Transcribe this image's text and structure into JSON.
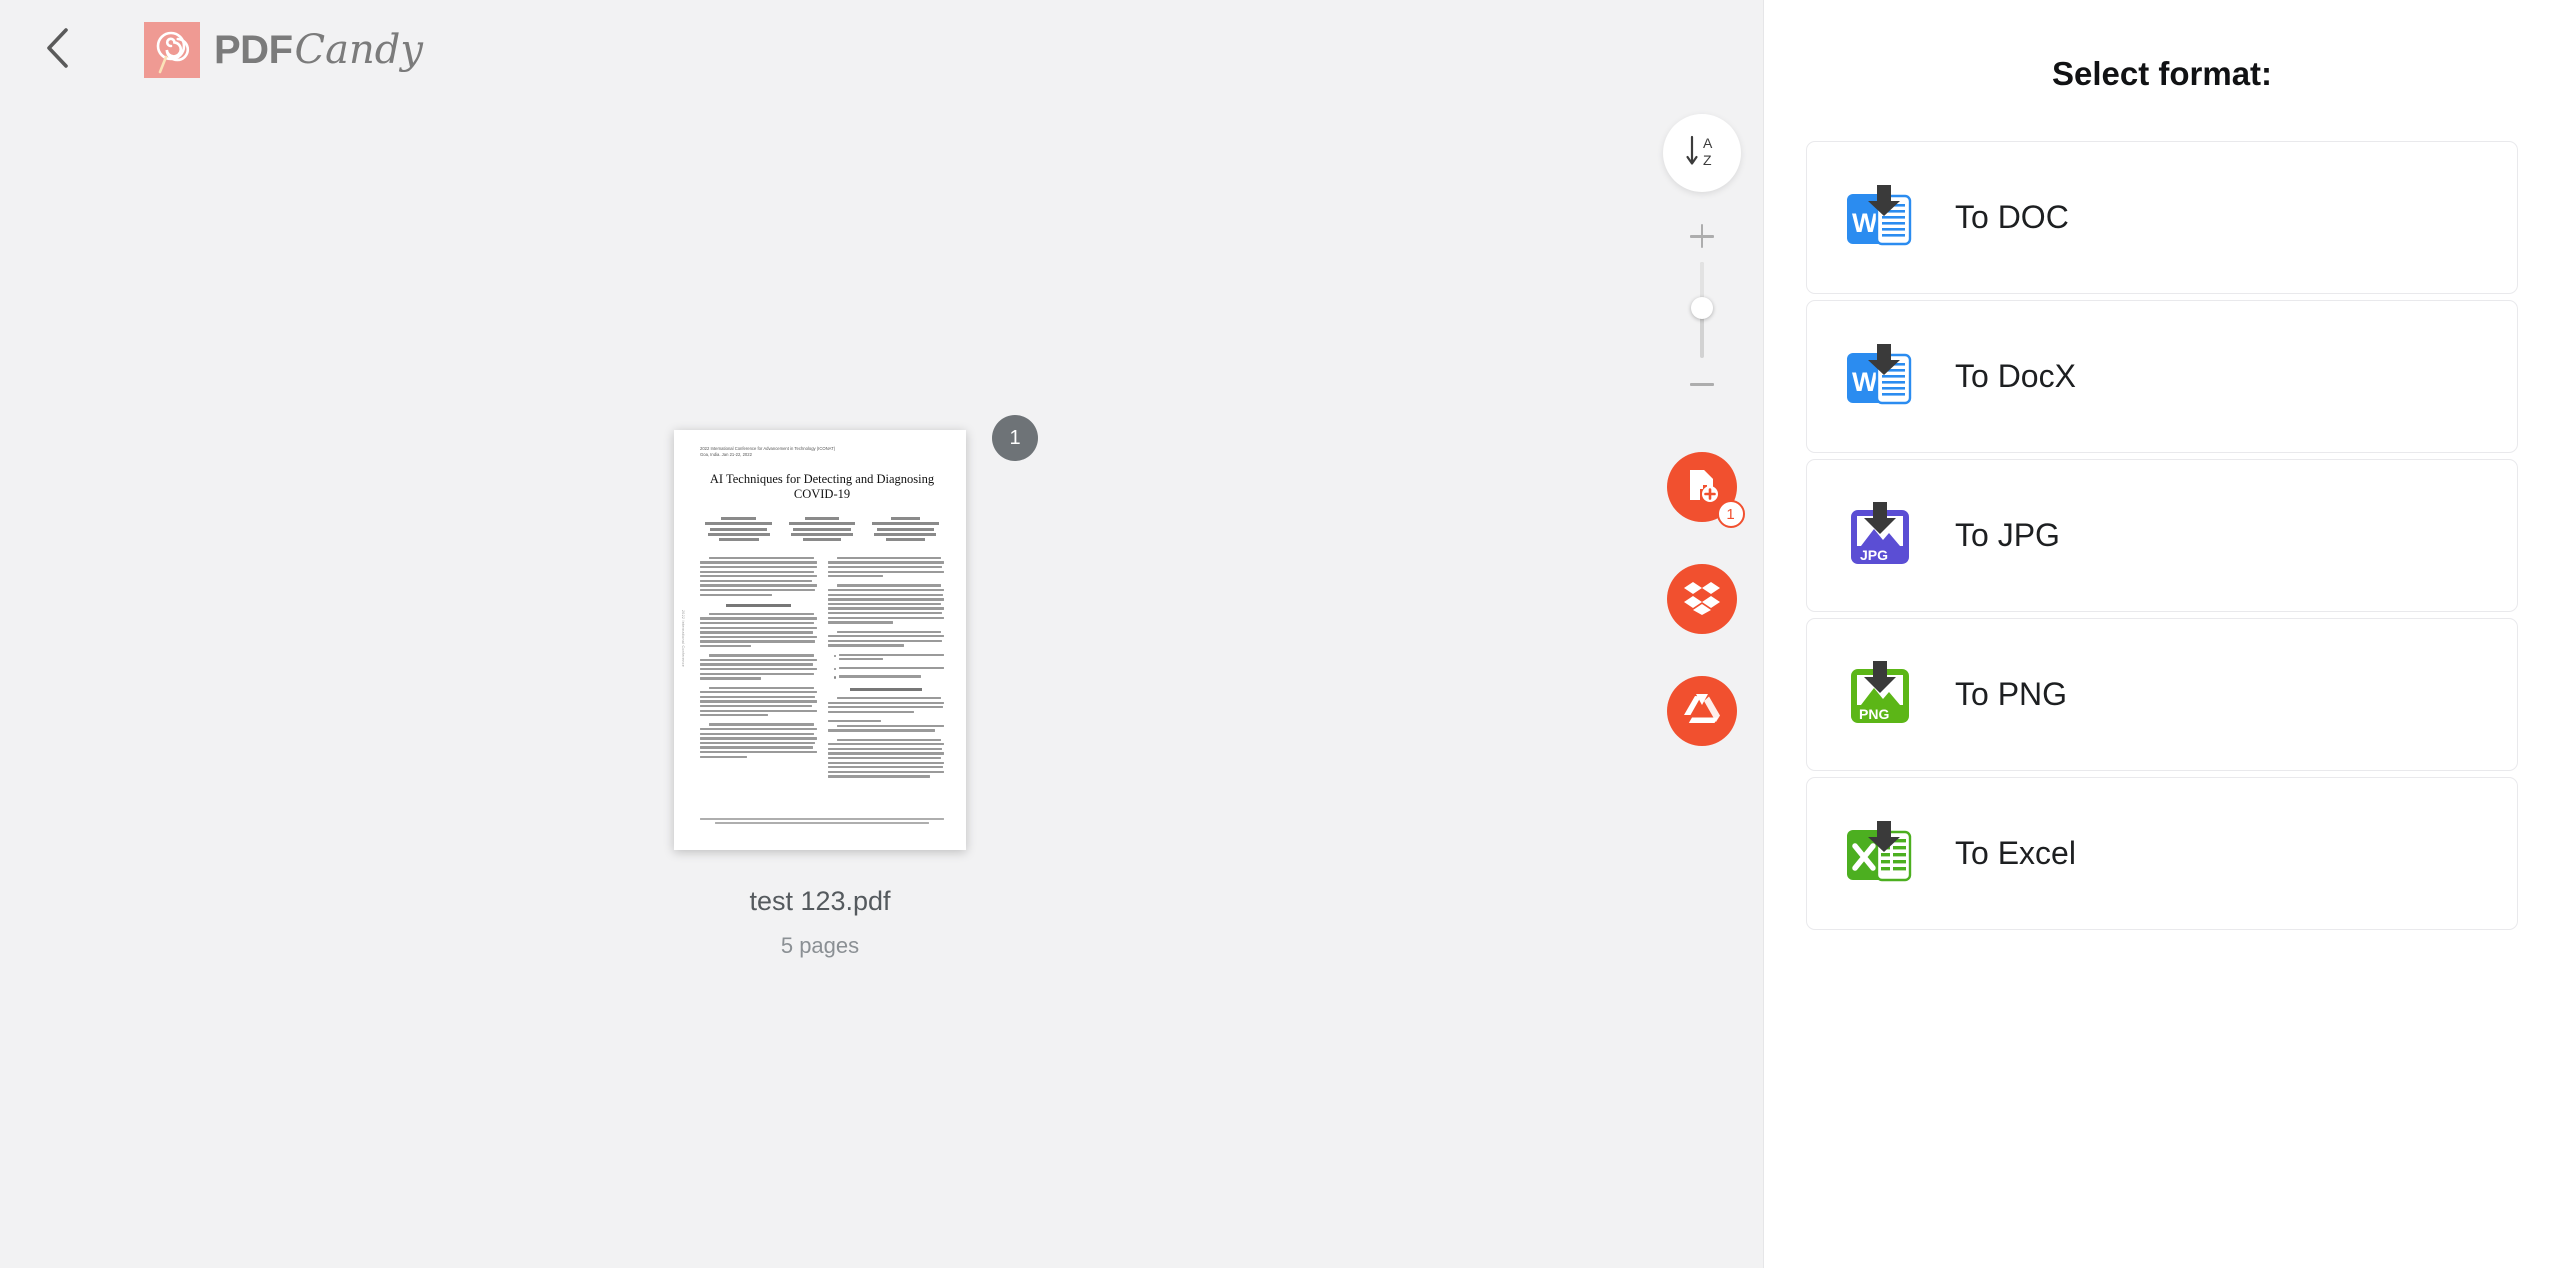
{
  "header": {
    "back_icon": "chevron-left-icon",
    "logo_mark_icon": "lollipop-icon",
    "logo_pdf": "PDF",
    "logo_candy": "Candy"
  },
  "workspace": {
    "file": {
      "name": "test 123.pdf",
      "pages_label": "5 pages",
      "page_badge": "1",
      "thumbnail": {
        "conference_line1": "2022 International Conference for Advancement in Technology (ICONAT)",
        "conference_line2": "Goa, India. Jan 21-22, 2022",
        "title": "AI Techniques for Detecting and Diagnosing COVID-19",
        "authors": [
          {
            "name": "Sahiti C Rama",
            "dept": "Department of Computer Science and Engineering",
            "org": "MS Ramaiah Institute of Technology",
            "city": "Bengaluru, India"
          },
          {
            "name": "Tanishaa Aras",
            "dept": "Department of Computer Science and Engineering",
            "org": "MS Ramaiah Institute of Technology",
            "city": "Bengaluru, India"
          },
          {
            "name": "Prakash A",
            "dept": "Department of Computer Science and Engineering",
            "org": "MS Ramaiah Institute of Technology",
            "city": "Bengaluru, India"
          }
        ],
        "section_heads": [
          "I. INTRODUCTION",
          "II. METHODOLOGY",
          "III. OVERVIEW OF COVID-19"
        ],
        "footer": "©IEEE 2022. This article is free to access and download, along with rights for full text and data mining, re-use and analysis."
      }
    },
    "rail": {
      "sort_icon": "sort-alpha-down-icon",
      "sort_letters": [
        "A",
        "Z"
      ],
      "zoom_plus_icon": "plus-icon",
      "zoom_minus_icon": "minus-icon",
      "zoom_value": 55,
      "add_file_icon": "add-file-icon",
      "add_file_badge": "1",
      "dropbox_icon": "dropbox-icon",
      "google_drive_icon": "google-drive-icon",
      "accent_color": "#f1502f"
    }
  },
  "panel": {
    "title": "Select format:",
    "formats": [
      {
        "label": "To DOC",
        "icon": "word-doc-download-icon",
        "color": "#2b8cf0"
      },
      {
        "label": "To DocX",
        "icon": "word-docx-download-icon",
        "color": "#2b8cf0"
      },
      {
        "label": "To JPG",
        "icon": "jpg-download-icon",
        "color": "#5b4ed4",
        "tag": "JPG"
      },
      {
        "label": "To PNG",
        "icon": "png-download-icon",
        "color": "#5cb617",
        "tag": "PNG"
      },
      {
        "label": "To Excel",
        "icon": "excel-download-icon",
        "color": "#4caf20"
      }
    ]
  }
}
